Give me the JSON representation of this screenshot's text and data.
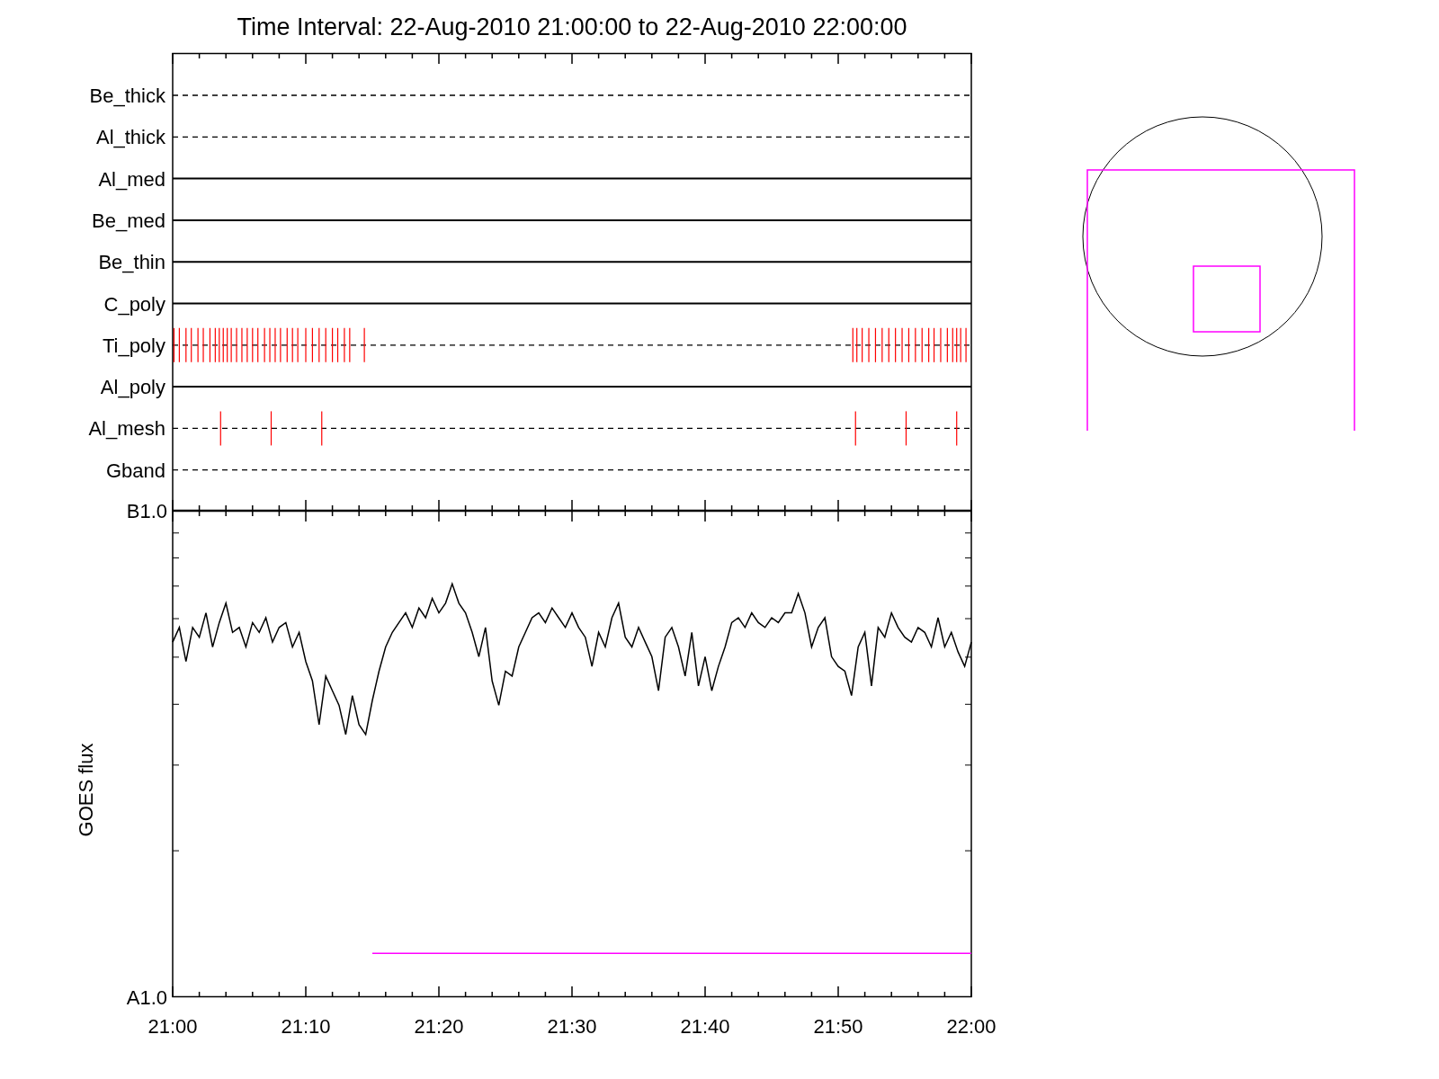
{
  "title": "Time Interval: 22-Aug-2010 21:00:00 to 22-Aug-2010 22:00:00",
  "top_panel": {
    "rows": [
      {
        "label": "Be_thick",
        "kind": "dashed"
      },
      {
        "label": "Al_thick",
        "kind": "dashed"
      },
      {
        "label": "Al_med",
        "kind": "solid"
      },
      {
        "label": "Be_med",
        "kind": "solid"
      },
      {
        "label": "Be_thin",
        "kind": "solid"
      },
      {
        "label": "C_poly",
        "kind": "solid"
      },
      {
        "label": "Ti_poly",
        "kind": "events"
      },
      {
        "label": "Al_poly",
        "kind": "solid"
      },
      {
        "label": "Al_mesh",
        "kind": "events"
      },
      {
        "label": "Gband",
        "kind": "dashed"
      }
    ]
  },
  "bottom_panel": {
    "y_axis_title": "GOES flux",
    "y_axis_labels": [
      "B1.0",
      "A1.0"
    ],
    "x_axis_labels": [
      "21:00",
      "21:10",
      "21:20",
      "21:30",
      "21:40",
      "21:50",
      "22:00"
    ]
  }
}
